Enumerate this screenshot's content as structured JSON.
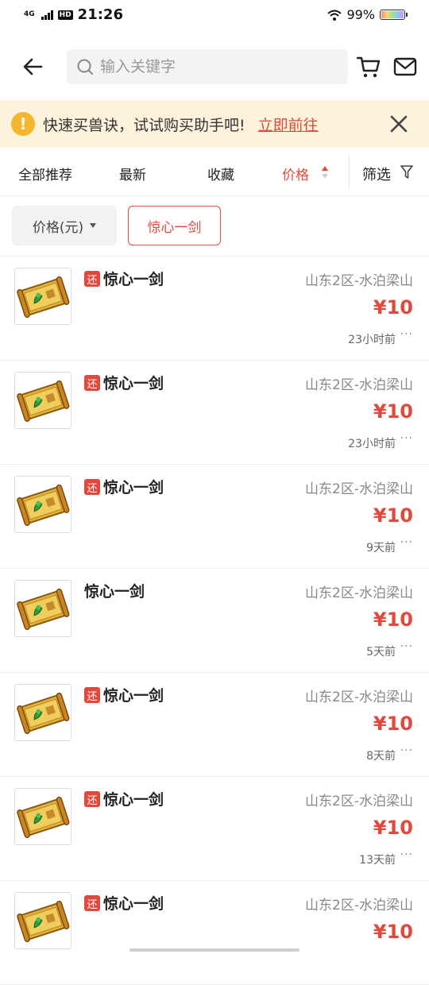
{
  "status": {
    "network": "4G",
    "hd": "HD",
    "time": "21:26",
    "battery": "99%"
  },
  "search": {
    "placeholder": "输入关键字"
  },
  "banner": {
    "text": "快速买兽诀，试试购买助手吧!",
    "link": "立即前往"
  },
  "sort": {
    "tabs": [
      "全部推荐",
      "最新",
      "收藏",
      "价格"
    ],
    "active": "价格",
    "filter": "筛选"
  },
  "chips": {
    "price_label": "价格(元)",
    "keyword": "惊心一剑"
  },
  "tag_label": "还",
  "listings": [
    {
      "has_tag": true,
      "title": "惊心一剑",
      "server": "山东2区-水泊梁山",
      "price": "¥10",
      "time": "23小时前"
    },
    {
      "has_tag": true,
      "title": "惊心一剑",
      "server": "山东2区-水泊梁山",
      "price": "¥10",
      "time": "23小时前"
    },
    {
      "has_tag": true,
      "title": "惊心一剑",
      "server": "山东2区-水泊梁山",
      "price": "¥10",
      "time": "9天前"
    },
    {
      "has_tag": false,
      "title": "惊心一剑",
      "server": "山东2区-水泊梁山",
      "price": "¥10",
      "time": "5天前"
    },
    {
      "has_tag": true,
      "title": "惊心一剑",
      "server": "山东2区-水泊梁山",
      "price": "¥10",
      "time": "8天前"
    },
    {
      "has_tag": true,
      "title": "惊心一剑",
      "server": "山东2区-水泊梁山",
      "price": "¥10",
      "time": "13天前"
    },
    {
      "has_tag": true,
      "title": "惊心一剑",
      "server": "山东2区-水泊梁山",
      "price": "¥10",
      "time": ""
    }
  ],
  "colors": {
    "accent": "#e2493c",
    "banner_bg": "#fdf3dc",
    "warning": "#f5b52e"
  },
  "icons": {
    "item_image": "scroll-book-icon",
    "more": "more-dots-icon"
  }
}
